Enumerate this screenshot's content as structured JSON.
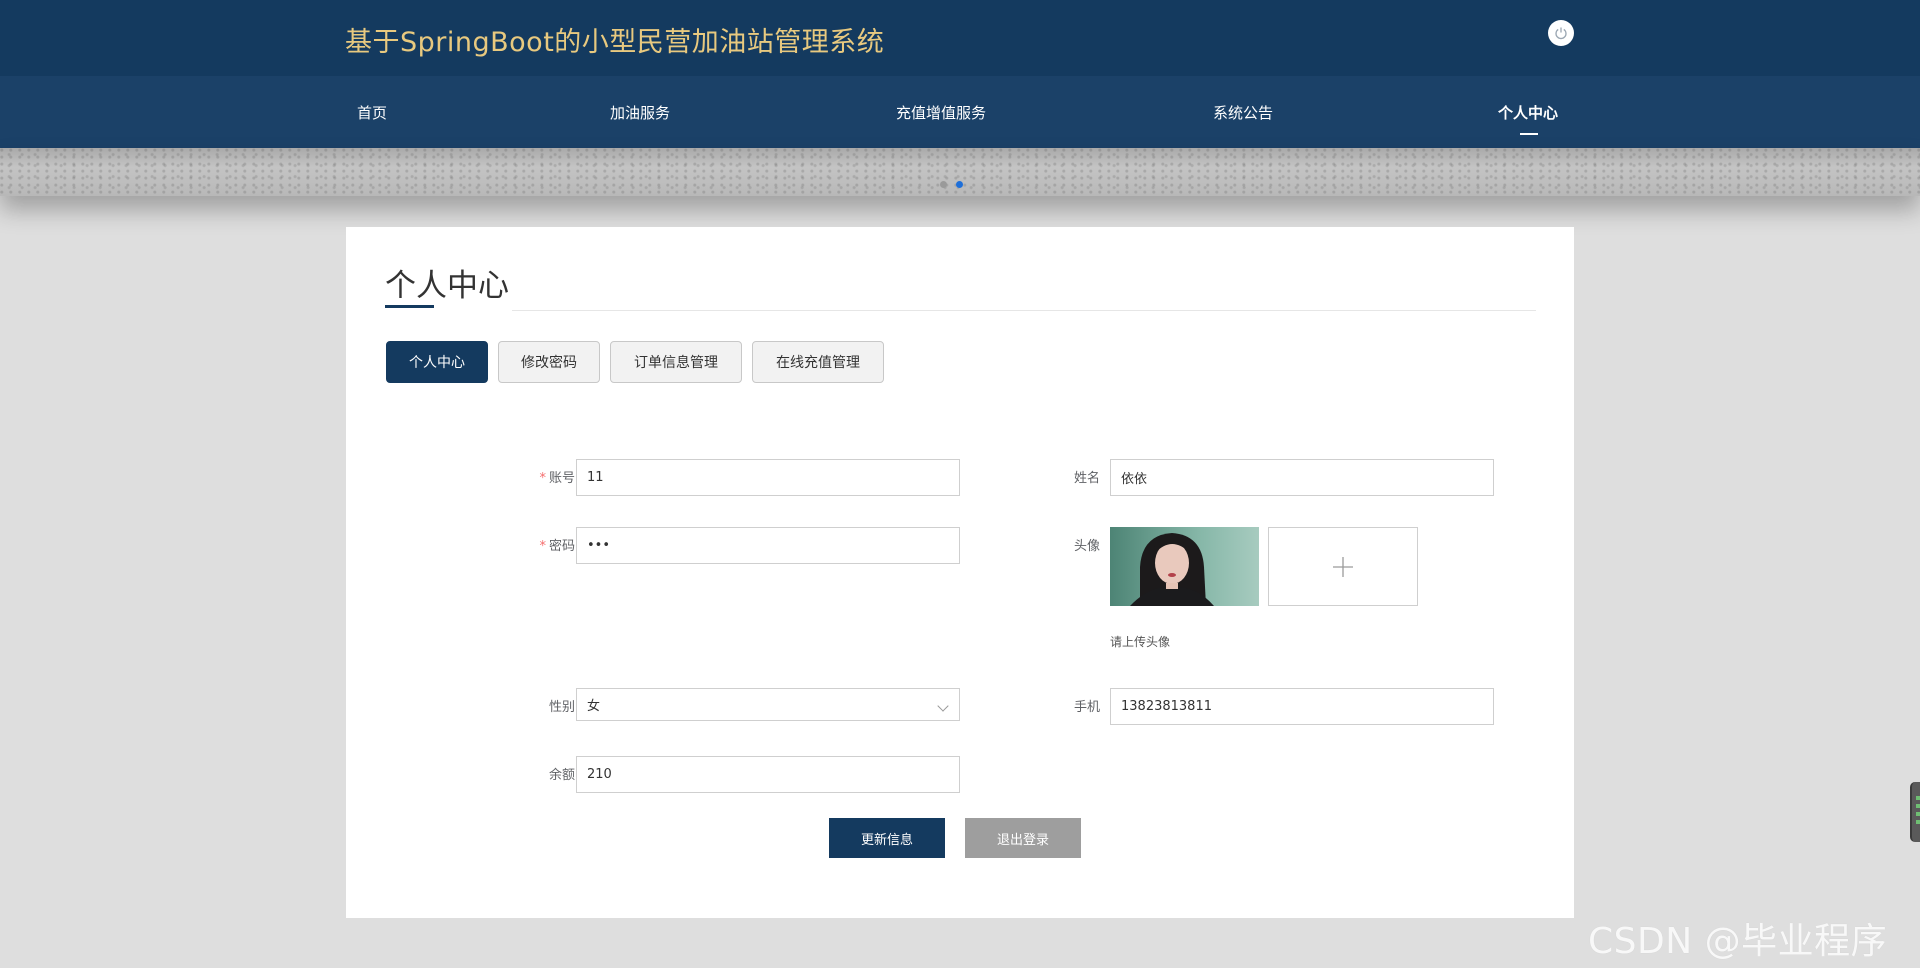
{
  "header": {
    "site_title": "基于SpringBoot的小型民营加油站管理系统",
    "logout_icon": "power-icon"
  },
  "nav": {
    "items": [
      {
        "label": "首页"
      },
      {
        "label": "加油服务"
      },
      {
        "label": "充值增值服务"
      },
      {
        "label": "系统公告"
      },
      {
        "label": "个人中心"
      }
    ],
    "active_index": 4
  },
  "banner": {
    "dots": 2,
    "active_dot": 1
  },
  "page": {
    "title": "个人中心",
    "tabs": [
      {
        "label": "个人中心"
      },
      {
        "label": "修改密码"
      },
      {
        "label": "订单信息管理"
      },
      {
        "label": "在线充值管理"
      }
    ],
    "active_tab": 0
  },
  "form": {
    "required_mark": "*",
    "account": {
      "label": "账号",
      "value": "11"
    },
    "password": {
      "label": "密码",
      "value": "•••"
    },
    "gender": {
      "label": "性别",
      "value": "女"
    },
    "balance": {
      "label": "余额",
      "value": "210"
    },
    "name": {
      "label": "姓名",
      "value": "依依"
    },
    "avatar": {
      "label": "头像",
      "hint": "请上传头像",
      "upload_icon": "plus-icon"
    },
    "phone": {
      "label": "手机",
      "value": "13823813811"
    }
  },
  "actions": {
    "update_label": "更新信息",
    "logout_label": "退出登录"
  },
  "colors": {
    "primary": "#143a5f",
    "nav": "#1b4168",
    "title_gold": "#e8c97f",
    "secondary_button": "#9e9e9e"
  },
  "watermark": "CSDN @毕业程序员"
}
